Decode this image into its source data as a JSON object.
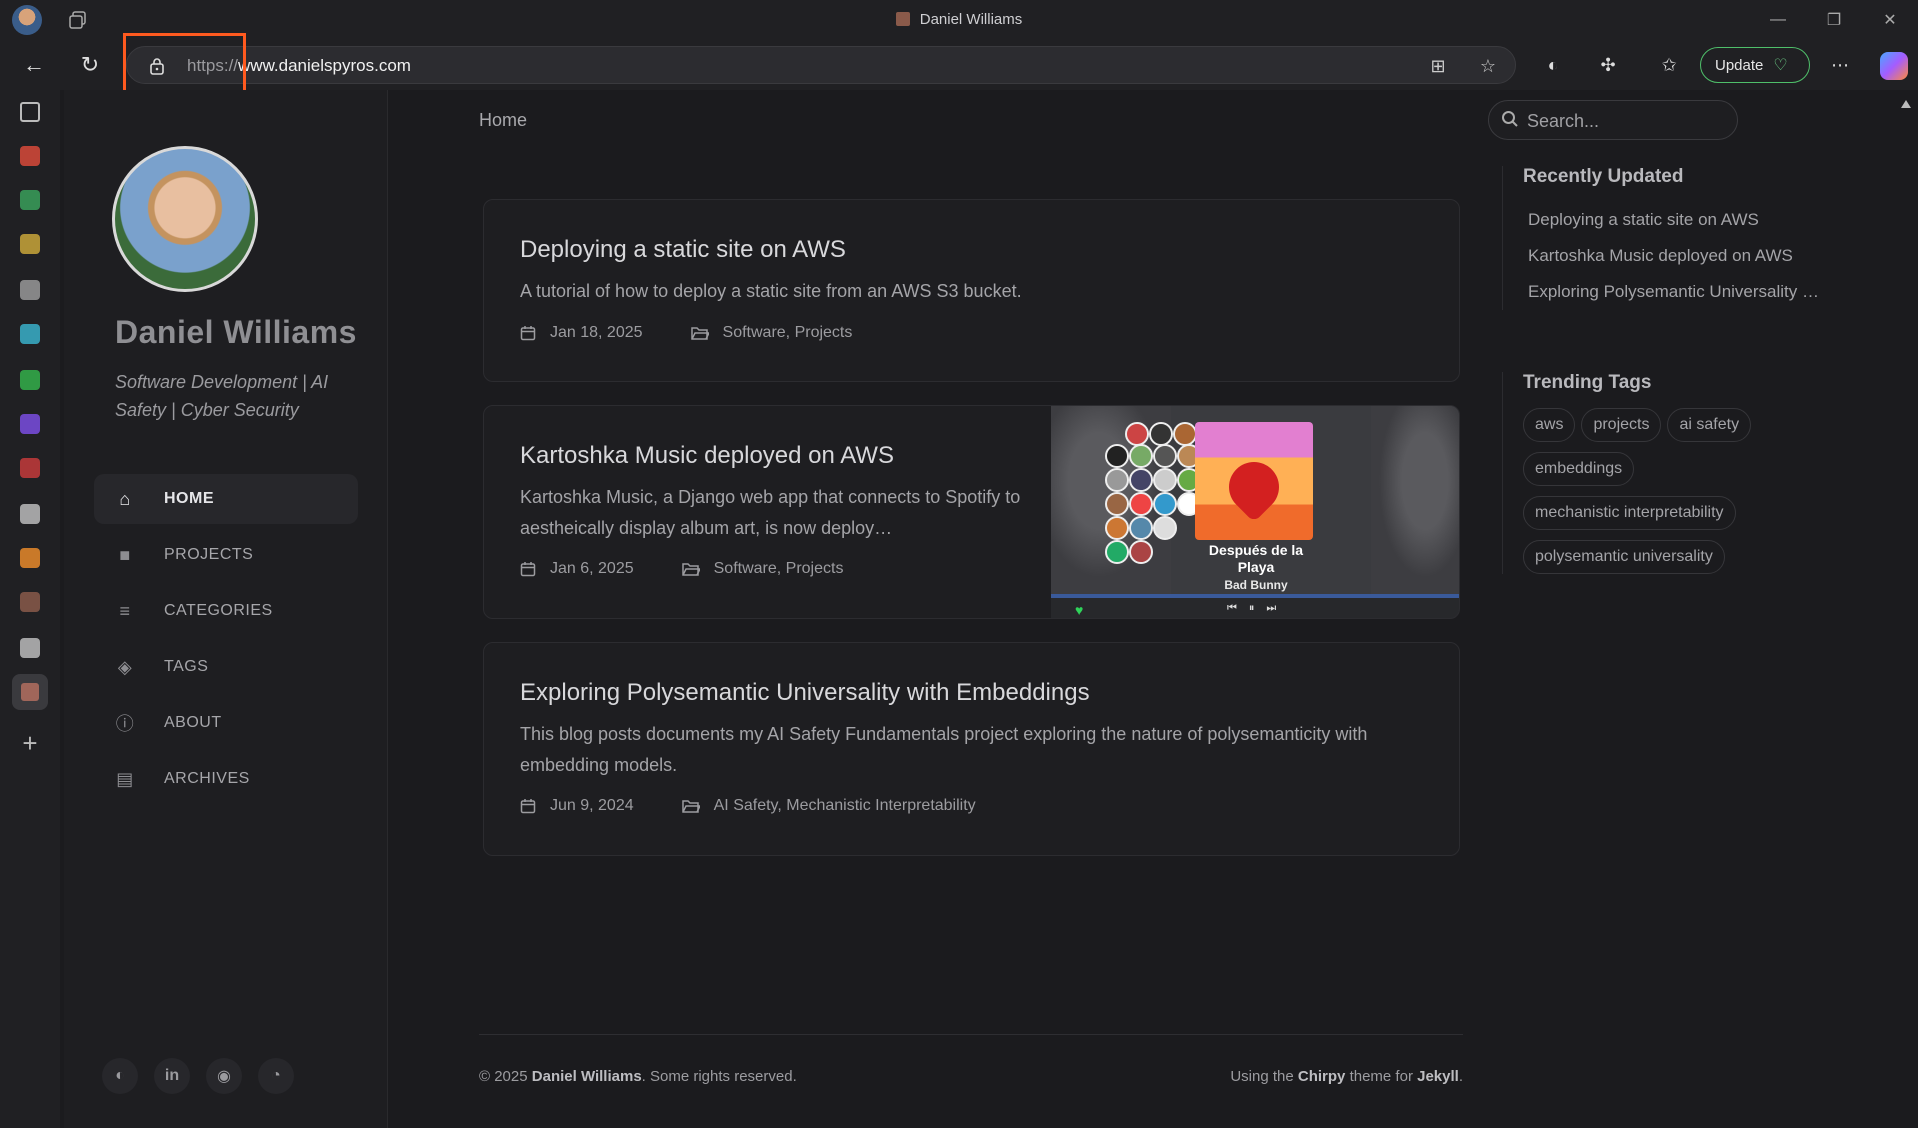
{
  "window": {
    "title": "Daniel Williams",
    "controls": [
      "minimize",
      "restore",
      "close"
    ]
  },
  "toolbar": {
    "url_scheme": "https://",
    "url_host": "www.danielspyros.com",
    "update_label": "Update",
    "icons": [
      "back-arrow-icon",
      "refresh-icon",
      "lock-icon",
      "app-grid-icon",
      "star-icon",
      "shield-icon",
      "extensions-icon",
      "favorites-icon",
      "more-icon",
      "copilot-icon"
    ]
  },
  "appbar": {
    "items": [
      {
        "icon": "sidebar-icon",
        "color": "#bbbbbb"
      },
      {
        "icon": "gmail-icon",
        "color": "#d84a3a"
      },
      {
        "icon": "maps-icon",
        "color": "#3aa05a"
      },
      {
        "icon": "striped-icon",
        "color": "#c9a63a"
      },
      {
        "icon": "openai-icon",
        "color": "#999999"
      },
      {
        "icon": "tailwind-icon",
        "color": "#3ab0c9"
      },
      {
        "icon": "calendar-icon",
        "color": "#34b04a"
      },
      {
        "icon": "purple-app-icon",
        "color": "#7a4de0"
      },
      {
        "icon": "red-app-icon",
        "color": "#c43b3b"
      },
      {
        "icon": "github-icon",
        "color": "#bbbbbb"
      },
      {
        "icon": "stackoverflow-icon",
        "color": "#e88a2a"
      },
      {
        "icon": "site-favicon",
        "color": "#8a5a4a"
      },
      {
        "icon": "github-icon",
        "color": "#bbbbbb"
      },
      {
        "icon": "active-site-icon",
        "color": "#a0665a"
      },
      {
        "icon": "add-icon",
        "color": "#bbbbbb"
      }
    ]
  },
  "profile": {
    "name": "Daniel Williams",
    "tagline": "Software Development | AI Safety | Cyber Security"
  },
  "nav": {
    "items": [
      {
        "label": "HOME",
        "icon": "home-icon",
        "glyph": "⌂"
      },
      {
        "label": "PROJECTS",
        "icon": "folder-icon",
        "glyph": "■"
      },
      {
        "label": "CATEGORIES",
        "icon": "list-icon",
        "glyph": "≡"
      },
      {
        "label": "TAGS",
        "icon": "tags-icon",
        "glyph": "◈"
      },
      {
        "label": "ABOUT",
        "icon": "info-icon",
        "glyph": "ⓘ"
      },
      {
        "label": "ARCHIVES",
        "icon": "archive-icon",
        "glyph": "▤"
      }
    ]
  },
  "main": {
    "breadcrumb": "Home",
    "search_placeholder": "Search..."
  },
  "posts": [
    {
      "title": "Deploying a static site on AWS",
      "description": "A tutorial of how to deploy a static site from an AWS S3 bucket.",
      "date": "Jan 18, 2025",
      "categories": "Software, Projects"
    },
    {
      "title": "Kartoshka Music deployed on AWS",
      "description": "Kartoshka Music, a Django web app that connects to Spotify to aestheically display album art, is now deploy…",
      "date": "Jan 6, 2025",
      "categories": "Software, Projects",
      "preview": {
        "song": "Después de la Playa",
        "artist": "Bad Bunny"
      }
    },
    {
      "title": "Exploring Polysemantic Universality with Embeddings",
      "description": "This blog posts documents my AI Safety Fundamentals project exploring the nature of polysemanticity with embedding models.",
      "date": "Jun 9, 2024",
      "categories": "AI Safety, Mechanistic Interpretability"
    }
  ],
  "recently_updated": {
    "heading": "Recently Updated",
    "items": [
      "Deploying a static site on AWS",
      "Kartoshka Music deployed on AWS",
      "Exploring Polysemantic Universality …"
    ]
  },
  "trending_tags": {
    "heading": "Trending Tags",
    "items": [
      "aws",
      "projects",
      "ai safety",
      "embeddings",
      "mechanistic interpretability",
      "polysemantic universality"
    ]
  },
  "footer": {
    "copyright_prefix": "© 2025 ",
    "copyright_name": "Daniel Williams",
    "copyright_suffix": ". Some rights reserved.",
    "theme_prefix": "Using the ",
    "theme_name": "Chirpy",
    "theme_middle": " theme for ",
    "theme_engine": "Jekyll",
    "theme_suffix": "."
  }
}
